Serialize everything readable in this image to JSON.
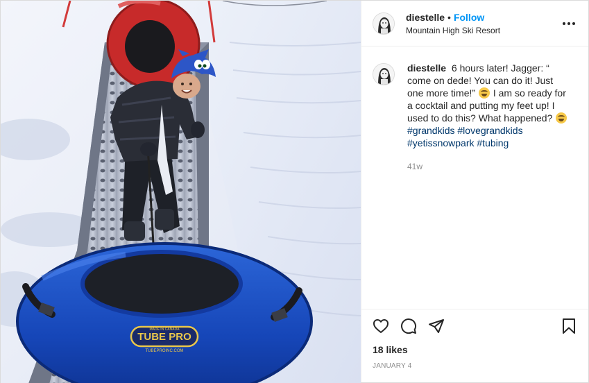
{
  "post": {
    "username": "diestelle",
    "dot": "•",
    "follow_label": "Follow",
    "location": "Mountain High Ski Resort",
    "more_label": "•••"
  },
  "photo": {
    "tube_brand": "TUBE PRO",
    "tube_small_top": "MADE IN CANADA",
    "tube_small_bottom": "TUBEPROINC.COM"
  },
  "caption": {
    "username": "diestelle",
    "text_1": "6 hours later! Jagger: “ come on dede! You can do it! Just one more time!”",
    "text_2": "I am so ready for a cocktail and putting my feet up! I used to do this? What happened?",
    "tags": [
      "#grandkids",
      "#lovegrandkids",
      "#yetissnowpark",
      "#tubing"
    ],
    "time": "41w"
  },
  "actions": {
    "like_icon": "heart-icon",
    "comment_icon": "comment-icon",
    "share_icon": "paper-plane-icon",
    "save_icon": "bookmark-icon"
  },
  "stats": {
    "likes": "18 likes",
    "date": "JANUARY 4"
  },
  "colors": {
    "follow": "#0095f6",
    "hashtag": "#00376b",
    "muted": "#8e8e8e",
    "border": "#efefef"
  }
}
